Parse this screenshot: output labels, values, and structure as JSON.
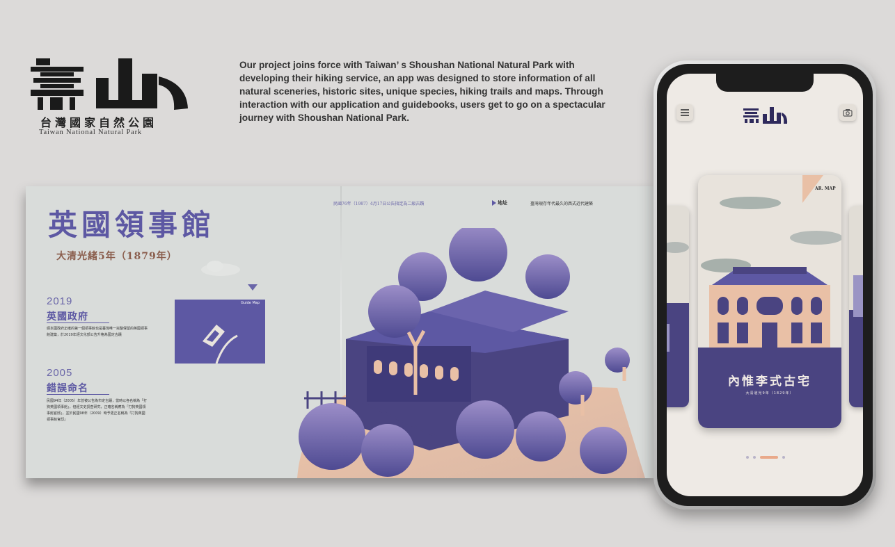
{
  "brand": {
    "name_cn": "台灣國家自然公園",
    "name_en": "Taiwan National Natural Park"
  },
  "description": "Our project joins force with Taiwan’ s Shoushan National Natural Park with developing their hiking service, an app was designed to store information of all natural sceneries, historic sites, unique species, hiking trails and maps. Through interaction with our application and guidebooks, users get to go on a spectacular journey with Shoushan National Park.",
  "spread": {
    "title": "英國領事館",
    "subtitle": "大清光緒5年（1879年）",
    "top_note": "民國76年（1987）4月17日公告指定為二級古蹟",
    "address_label": "地址",
    "address_value": "臺灣現存年代最久的西式近代建築",
    "guide_map_label": "Guide Map",
    "timeline": [
      {
        "year": "2019",
        "title": "英國政府",
        "body": "經本國政府正確的第一個領事館也是臺灣唯一完整保留的英國領事館建築，於2019年經文化部公告升格為國定古蹟"
      },
      {
        "year": "2005",
        "title": "錯誤命名",
        "body": "民國94年（2005）年曾被公告為市定古蹟，當時以各名稱為「打狗英國領事館」，但經文史調查研究，正確名稱應為「打狗英國領事館官邸」，並於民國98年（2009）時予更正名稱為「打狗英國領事館官邸」"
      }
    ]
  },
  "phone": {
    "card_title": "內惟李式古宅",
    "card_subtitle": "大清道光9年（1829年）",
    "card_badge": "AR. MAP",
    "pager_active_index": 2,
    "pager_count": 4
  },
  "colors": {
    "accent": "#5d58a3",
    "dark_accent": "#4a4481",
    "peach": "#e9c0a6",
    "background": "#dcdad9"
  }
}
